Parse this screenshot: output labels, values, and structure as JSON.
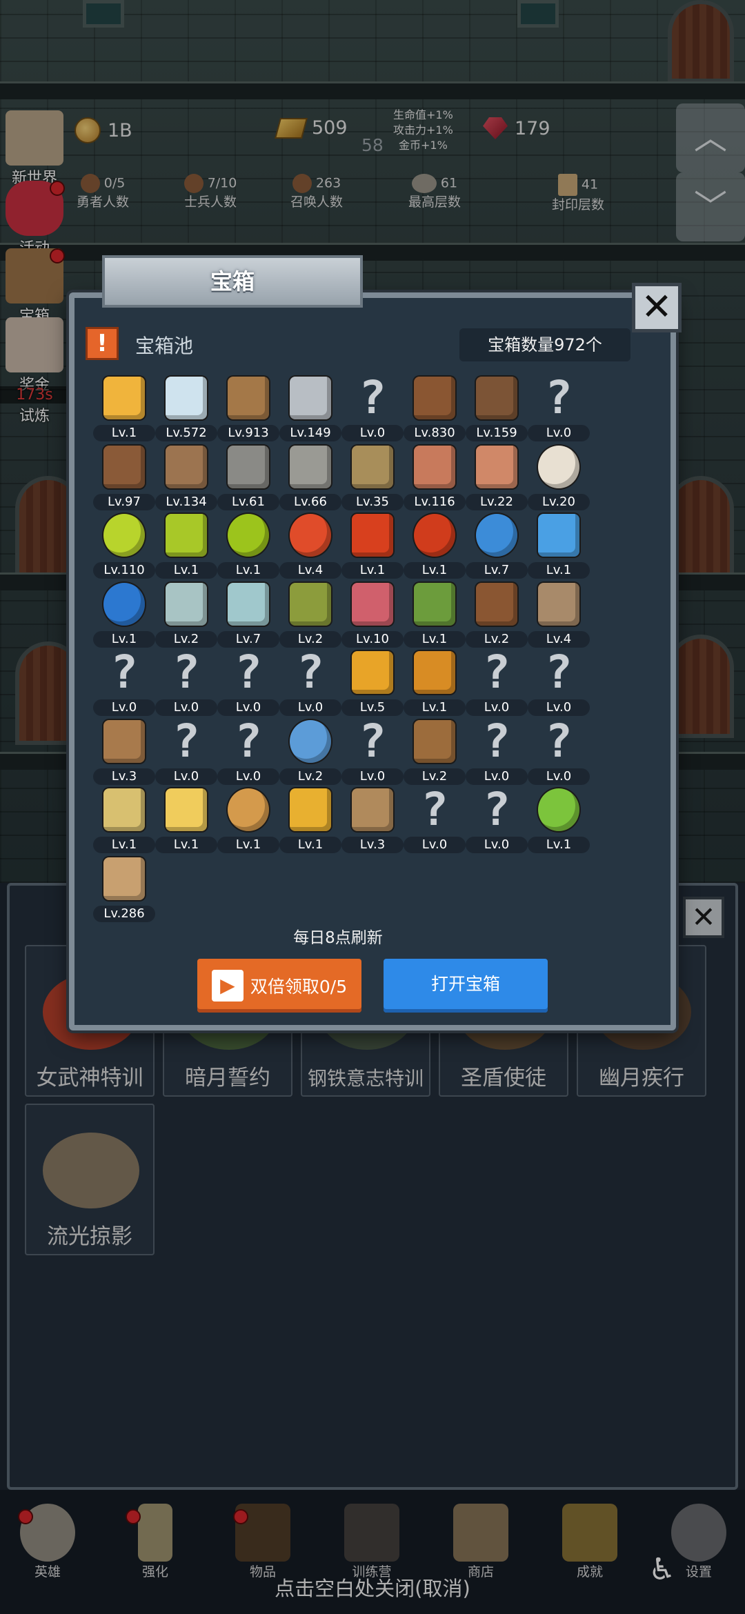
{
  "stats": {
    "gold": "1B",
    "bars": "509",
    "bars_sub": "58",
    "gems": "179",
    "bonus": [
      "生命值+1%",
      "攻击力+1%",
      "金币+1%"
    ],
    "heroes_val": "0/5",
    "heroes_label": "勇者人数",
    "soldiers_val": "7/10",
    "soldiers_label": "士兵人数",
    "summon_val": "263",
    "summon_label": "召唤人数",
    "top_floor_val": "61",
    "top_floor_label": "最高层数",
    "seal_val": "41",
    "seal_label": "封印层数"
  },
  "side_menu": [
    "新世界",
    "活动",
    "宝箱",
    "奖金",
    "试炼"
  ],
  "side_timer": "173s",
  "modal": {
    "title": "宝箱",
    "pool_label": "宝箱池",
    "count_label": "宝箱数量972个",
    "refresh_note": "每日8点刷新",
    "double_label": "双倍领取0/5",
    "open_label": "打开宝箱",
    "items": [
      {
        "icon": "crown-icon",
        "lv": "Lv.1",
        "color": "#f0b43c"
      },
      {
        "icon": "diamond-icon",
        "lv": "Lv.572",
        "color": "#cfe3ee"
      },
      {
        "icon": "bronze-sword-icon",
        "lv": "Lv.913",
        "color": "#a47848"
      },
      {
        "icon": "iron-sword-icon",
        "lv": "Lv.149",
        "color": "#b8bec4"
      },
      {
        "icon": "unknown-icon",
        "lv": "Lv.0",
        "color": ""
      },
      {
        "icon": "leather-armor-icon",
        "lv": "Lv.830",
        "color": "#8a5632"
      },
      {
        "icon": "backpack-armor-icon",
        "lv": "Lv.159",
        "color": "#7c5436"
      },
      {
        "icon": "unknown-icon",
        "lv": "Lv.0",
        "color": ""
      },
      {
        "icon": "leather-helmet-icon",
        "lv": "Lv.97",
        "color": "#8a5a38"
      },
      {
        "icon": "wooden-sword-icon",
        "lv": "Lv.134",
        "color": "#9c7450"
      },
      {
        "icon": "knight-helmet-icon",
        "lv": "Lv.61",
        "color": "#8a8a86"
      },
      {
        "icon": "hammer-icon",
        "lv": "Lv.66",
        "color": "#9a9a94"
      },
      {
        "icon": "great-helm-icon",
        "lv": "Lv.35",
        "color": "#a88e5a"
      },
      {
        "icon": "meat-leg-icon",
        "lv": "Lv.116",
        "color": "#c87a5c"
      },
      {
        "icon": "steak-icon",
        "lv": "Lv.22",
        "color": "#d08868"
      },
      {
        "icon": "rice-bowl-icon",
        "lv": "Lv.20",
        "color": "#e8e0d2"
      },
      {
        "icon": "green-potion-icon",
        "lv": "Lv.110",
        "color": "#b8d42c"
      },
      {
        "icon": "green-flask-icon",
        "lv": "Lv.1",
        "color": "#a8c828"
      },
      {
        "icon": "green-round-potion-icon",
        "lv": "Lv.1",
        "color": "#9cc41c"
      },
      {
        "icon": "red-potion-icon",
        "lv": "Lv.4",
        "color": "#e04c2a"
      },
      {
        "icon": "red-flask-icon",
        "lv": "Lv.1",
        "color": "#d8401e"
      },
      {
        "icon": "red-round-potion-icon",
        "lv": "Lv.1",
        "color": "#d03c1c"
      },
      {
        "icon": "blue-potion-icon",
        "lv": "Lv.7",
        "color": "#3c8cd8"
      },
      {
        "icon": "blue-flask-icon",
        "lv": "Lv.1",
        "color": "#4aa0e4"
      },
      {
        "icon": "blue-round-potion-icon",
        "lv": "Lv.1",
        "color": "#2c78d0"
      },
      {
        "icon": "clear-vial-icon",
        "lv": "Lv.2",
        "color": "#a8c4c4"
      },
      {
        "icon": "clear-tube-icon",
        "lv": "Lv.7",
        "color": "#a0c8cc"
      },
      {
        "icon": "olive-bottle-icon",
        "lv": "Lv.2",
        "color": "#8c9c3c"
      },
      {
        "icon": "pink-vial-icon",
        "lv": "Lv.10",
        "color": "#d0606c"
      },
      {
        "icon": "winged-boot-icon",
        "lv": "Lv.1",
        "color": "#6c9c3c"
      },
      {
        "icon": "leather-boot-icon",
        "lv": "Lv.2",
        "color": "#8a5632"
      },
      {
        "icon": "tan-boot-icon",
        "lv": "Lv.4",
        "color": "#a88a6a"
      },
      {
        "icon": "unknown-icon",
        "lv": "Lv.0",
        "color": ""
      },
      {
        "icon": "unknown-icon",
        "lv": "Lv.0",
        "color": ""
      },
      {
        "icon": "unknown-icon",
        "lv": "Lv.0",
        "color": ""
      },
      {
        "icon": "unknown-icon",
        "lv": "Lv.0",
        "color": ""
      },
      {
        "icon": "fire-wand-icon",
        "lv": "Lv.5",
        "color": "#e8a428"
      },
      {
        "icon": "fire-staff-icon",
        "lv": "Lv.1",
        "color": "#d88c24"
      },
      {
        "icon": "unknown-icon",
        "lv": "Lv.0",
        "color": ""
      },
      {
        "icon": "unknown-icon",
        "lv": "Lv.0",
        "color": ""
      },
      {
        "icon": "crook-staff-icon",
        "lv": "Lv.3",
        "color": "#a87a4c"
      },
      {
        "icon": "unknown-icon",
        "lv": "Lv.0",
        "color": ""
      },
      {
        "icon": "unknown-icon",
        "lv": "Lv.0",
        "color": ""
      },
      {
        "icon": "blue-orb-staff-icon",
        "lv": "Lv.2",
        "color": "#5c9cd8"
      },
      {
        "icon": "unknown-icon",
        "lv": "Lv.0",
        "color": ""
      },
      {
        "icon": "leather-pack-icon",
        "lv": "Lv.2",
        "color": "#9c6c3c"
      },
      {
        "icon": "unknown-icon",
        "lv": "Lv.0",
        "color": ""
      },
      {
        "icon": "unknown-icon",
        "lv": "Lv.0",
        "color": ""
      },
      {
        "icon": "torch-staff-icon",
        "lv": "Lv.1",
        "color": "#d8c070"
      },
      {
        "icon": "cheese-icon",
        "lv": "Lv.1",
        "color": "#f0cc5c"
      },
      {
        "icon": "pie-icon",
        "lv": "Lv.1",
        "color": "#d49a4c"
      },
      {
        "icon": "honey-jar-icon",
        "lv": "Lv.1",
        "color": "#e8b030"
      },
      {
        "icon": "bow-icon",
        "lv": "Lv.3",
        "color": "#b08a5c"
      },
      {
        "icon": "unknown-icon",
        "lv": "Lv.0",
        "color": ""
      },
      {
        "icon": "unknown-icon",
        "lv": "Lv.0",
        "color": ""
      },
      {
        "icon": "green-orb-wand-icon",
        "lv": "Lv.1",
        "color": "#7cc43c"
      },
      {
        "icon": "beer-mug-icon",
        "lv": "Lv.286",
        "color": "#c8a070"
      }
    ]
  },
  "training": [
    "女武神特训",
    "暗月誓约",
    "钢铁意志特训",
    "圣盾使徒",
    "幽月疾行",
    "流光掠影"
  ],
  "nav": [
    "英雄",
    "强化",
    "物品",
    "训练营",
    "商店",
    "成就",
    "设置"
  ],
  "close_hint": "点击空白处关闭(取消)"
}
